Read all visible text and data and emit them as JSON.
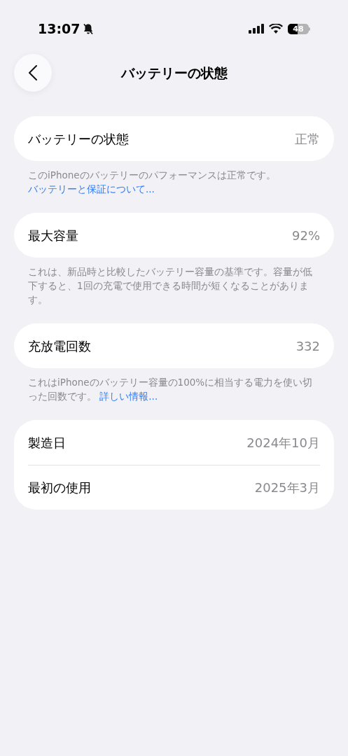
{
  "status_bar": {
    "time": "13:07",
    "battery": "48"
  },
  "nav": {
    "title": "バッテリーの状態"
  },
  "groups": [
    {
      "rows": [
        {
          "label": "バッテリーの状態",
          "value": "正常"
        }
      ],
      "footnote": {
        "text": "このiPhoneのバッテリーのパフォーマンスは正常です。",
        "link": "バッテリーと保証について..."
      }
    },
    {
      "rows": [
        {
          "label": "最大容量",
          "value": "92%"
        }
      ],
      "footnote": {
        "text": "これは、新品時と比較したバッテリー容量の基準です。容量が低下すると、1回の充電で使用できる時間が短くなることがあります。"
      }
    },
    {
      "rows": [
        {
          "label": "充放電回数",
          "value": "332"
        }
      ],
      "footnote": {
        "text": "これはiPhoneのバッテリー容量の100%に相当する電力を使い切った回数です。",
        "link": "詳しい情報..."
      }
    },
    {
      "rows": [
        {
          "label": "製造日",
          "value": "2024年10月"
        },
        {
          "label": "最初の使用",
          "value": "2025年3月"
        }
      ]
    }
  ]
}
